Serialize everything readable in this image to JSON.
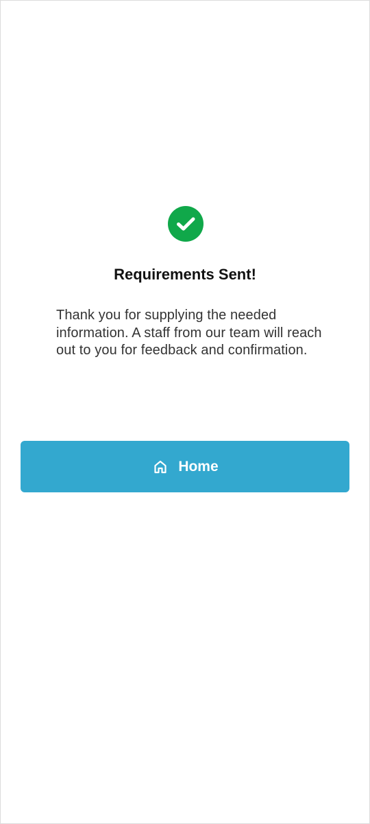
{
  "status": {
    "icon": "check-circle-icon",
    "icon_color": "#10a84a"
  },
  "confirmation": {
    "title": "Requirements Sent!",
    "message": "Thank you for supplying the needed information. A staff from our team will reach out to you for feedback and confirmation."
  },
  "actions": {
    "home_button": {
      "label": "Home",
      "icon": "home-icon",
      "background_color": "#33a8cf",
      "text_color": "#ffffff"
    }
  }
}
